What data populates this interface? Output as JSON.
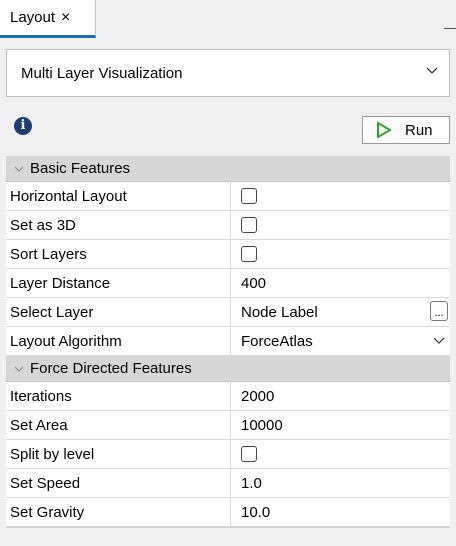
{
  "tab": {
    "label": "Layout",
    "close": "×"
  },
  "layout_selector": {
    "value": "Multi Layer Visualization"
  },
  "run_button": {
    "label": "Run"
  },
  "sections": {
    "basic": {
      "label": "Basic Features"
    },
    "force": {
      "label": "Force Directed Features"
    }
  },
  "basic_rows": {
    "horizontal_layout": {
      "label": "Horizontal Layout",
      "checked": false
    },
    "set_as_3d": {
      "label": "Set as 3D",
      "checked": false
    },
    "sort_layers": {
      "label": "Sort Layers",
      "checked": false
    },
    "layer_distance": {
      "label": "Layer Distance",
      "value": "400"
    },
    "select_layer": {
      "label": "Select Layer",
      "value": "Node Label",
      "button": "..."
    },
    "layout_algorithm": {
      "label": "Layout Algorithm",
      "value": "ForceAtlas"
    }
  },
  "force_rows": {
    "iterations": {
      "label": "Iterations",
      "value": "2000"
    },
    "set_area": {
      "label": "Set Area",
      "value": "10000"
    },
    "split_by_level": {
      "label": "Split by level",
      "checked": false
    },
    "set_speed": {
      "label": "Set Speed",
      "value": "1.0"
    },
    "set_gravity": {
      "label": "Set Gravity",
      "value": "10.0"
    }
  },
  "colors": {
    "tab_accent": "#1f6fb5",
    "run_icon": "#2aa52a",
    "info_icon": "#1c3d74",
    "section_bg": "#d7d7d7"
  },
  "icons": {
    "info": "info-icon",
    "run": "play-icon",
    "dropdown": "chevron-down-icon",
    "collapse": "chevron-down-icon"
  }
}
